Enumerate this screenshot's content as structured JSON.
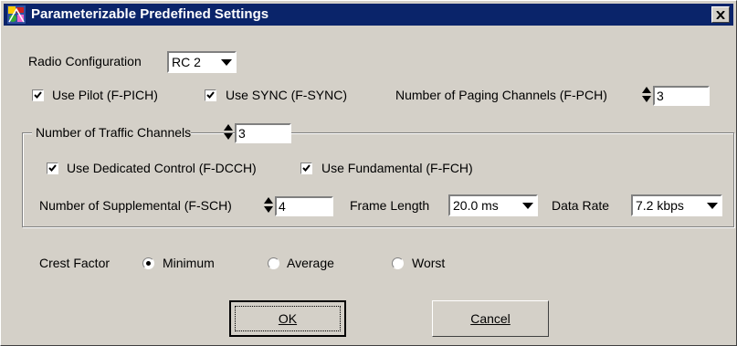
{
  "window": {
    "title": "Parameterizable Predefined Settings"
  },
  "radio_config": {
    "label": "Radio Configuration",
    "value": "RC 2"
  },
  "pilot": {
    "label": "Use Pilot (F-PICH)",
    "checked": true
  },
  "sync": {
    "label": "Use SYNC (F-SYNC)",
    "checked": true
  },
  "paging": {
    "label": "Number of Paging Channels (F-PCH)",
    "value": "3"
  },
  "traffic": {
    "label": "Number of Traffic Channels",
    "value": "3",
    "dcch": {
      "label": "Use Dedicated Control (F-DCCH)",
      "checked": true
    },
    "fch": {
      "label": "Use Fundamental (F-FCH)",
      "checked": true
    },
    "supplemental": {
      "label": "Number of Supplemental (F-SCH)",
      "value": "4"
    },
    "frame_length": {
      "label": "Frame Length",
      "value": "20.0 ms"
    },
    "data_rate": {
      "label": "Data Rate",
      "value": "7.2 kbps"
    }
  },
  "crest": {
    "label": "Crest Factor",
    "options": [
      "Minimum",
      "Average",
      "Worst"
    ],
    "selected": "Minimum"
  },
  "buttons": {
    "ok_label": "OK",
    "cancel_label": "Cancel"
  },
  "colors": {
    "titlebar": "#0a246a",
    "face": "#d4d0c8"
  }
}
